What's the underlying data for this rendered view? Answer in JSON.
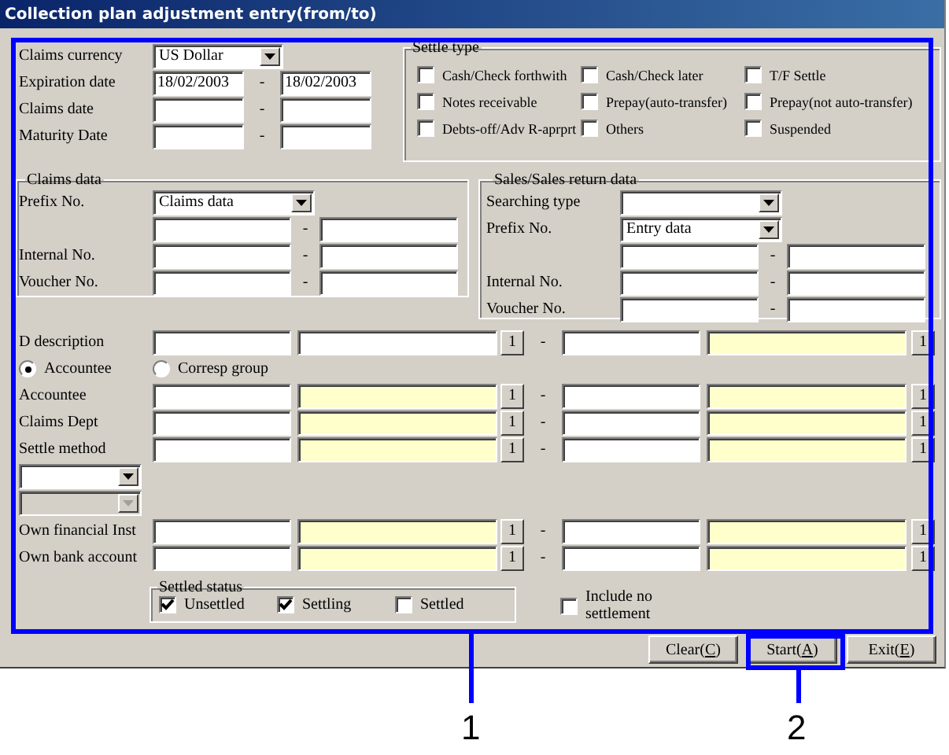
{
  "window": {
    "title": "Collection plan adjustment entry(from/to)"
  },
  "top_fields": [
    {
      "label": "Claims currency",
      "kind": "select",
      "value": "US Dollar"
    },
    {
      "label": "Expiration date",
      "kind": "range",
      "from": "18/02/2003",
      "to": "18/02/2003",
      "separator": "-"
    },
    {
      "label": "Claims date",
      "kind": "range",
      "separator": "-"
    },
    {
      "label": "Maturity Date",
      "kind": "range",
      "separator": "-"
    }
  ],
  "settle_type": {
    "title": "Settle type",
    "options": [
      {
        "label": "Cash/Check forthwith",
        "checked": false
      },
      {
        "label": "Cash/Check later",
        "checked": false
      },
      {
        "label": "T/F Settle",
        "checked": false
      },
      {
        "label": "Notes receivable",
        "checked": false
      },
      {
        "label": "Prepay(auto-transfer)",
        "checked": false
      },
      {
        "label": "Prepay(not auto-transfer)",
        "checked": false
      },
      {
        "label": "Debts-off/Adv R-aprprt",
        "checked": false
      },
      {
        "label": "Others",
        "checked": false
      },
      {
        "label": "Suspended",
        "checked": false
      }
    ]
  },
  "claims_data": {
    "title": "Claims data",
    "selects": [
      {
        "label": "Prefix No.",
        "value": "Claims data"
      }
    ],
    "rows": [
      {
        "separator": "-"
      },
      {
        "label": "Internal No.",
        "separator": "-"
      },
      {
        "label": "Voucher No.",
        "separator": "-"
      }
    ]
  },
  "sales_data": {
    "title": "Sales/Sales return data",
    "selects": [
      {
        "label": "Searching type"
      },
      {
        "label": "Prefix No.",
        "value": "Entry data"
      }
    ],
    "rows": [
      {
        "separator": "-"
      },
      {
        "label": "Internal No.",
        "separator": "-"
      },
      {
        "label": "Voucher No.",
        "separator": "-"
      }
    ]
  },
  "rows": [
    {
      "kind": "lookup",
      "label": "D description",
      "from_readonly": false,
      "to_readonly": true,
      "from_button": "1",
      "to_button": "1",
      "separator": "-"
    },
    {
      "kind": "radios",
      "options": [
        {
          "label": "Accountee",
          "selected": true
        },
        {
          "label": "Corresp group",
          "selected": false
        }
      ]
    },
    {
      "kind": "lookup",
      "label": "Accountee",
      "from_readonly": true,
      "to_readonly": true,
      "from_button": "1",
      "to_button": "1",
      "separator": "-"
    },
    {
      "kind": "lookup",
      "label": "Claims Dept",
      "from_readonly": true,
      "to_readonly": true,
      "from_button": "1",
      "to_button": "1",
      "separator": "-"
    },
    {
      "kind": "lookup",
      "label": "Settle method",
      "from_readonly": true,
      "to_readonly": true,
      "from_button": "1",
      "to_button": "1",
      "separator": "-"
    },
    {
      "kind": "dropdowns",
      "items": [
        {
          "disabled": false
        },
        {
          "disabled": true
        }
      ]
    },
    {
      "kind": "lookup",
      "label": "Own financial Inst",
      "from_readonly": true,
      "to_readonly": true,
      "from_button": "1",
      "to_button": "1",
      "separator": "-"
    },
    {
      "kind": "lookup",
      "label": "Own bank account",
      "from_readonly": true,
      "to_readonly": true,
      "from_button": "1",
      "to_button": "1",
      "separator": "-"
    }
  ],
  "settled_status": {
    "title": "Settled status",
    "options": [
      {
        "label": "Unsettled",
        "checked": true
      },
      {
        "label": "Settling",
        "checked": true
      },
      {
        "label": "Settled",
        "checked": false
      }
    ]
  },
  "include_no_settlement": {
    "label": "Include no settlement",
    "checked": false
  },
  "buttons": [
    {
      "label_parts": [
        "Clear(",
        "C",
        ")"
      ]
    },
    {
      "label_parts": [
        "Start(",
        "A",
        ")"
      ]
    },
    {
      "label_parts": [
        "Exit(",
        "E",
        ")"
      ]
    }
  ],
  "callouts": [
    {
      "label": "1"
    },
    {
      "label": "2"
    }
  ]
}
